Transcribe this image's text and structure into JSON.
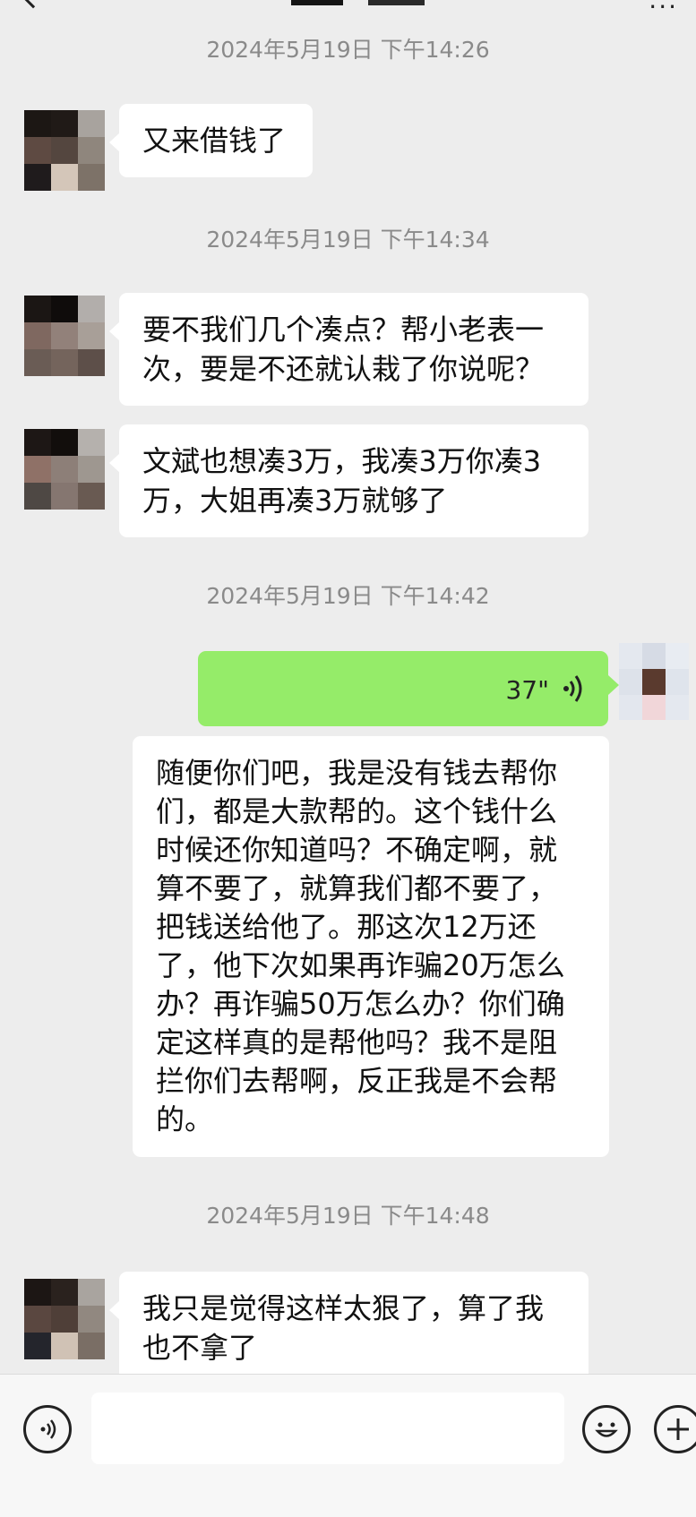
{
  "app": {
    "header": {
      "back_icon": "chevron-left-icon",
      "more_icon": "more-dots-icon",
      "more_text": "···"
    }
  },
  "messages": [
    {
      "kind": "timestamp",
      "text": "2024年5月19日 下午14:26"
    },
    {
      "kind": "incoming",
      "text": "又来借钱了"
    },
    {
      "kind": "timestamp",
      "text": "2024年5月19日 下午14:34"
    },
    {
      "kind": "incoming",
      "text": "要不我们几个凑点？帮小老表一\n次，要是不还就认栽了你说呢？"
    },
    {
      "kind": "incoming",
      "text": "文斌也想凑3万，我凑3万你凑3\n万，大姐再凑3万就够了"
    },
    {
      "kind": "timestamp",
      "text": "2024年5月19日 下午14:42"
    },
    {
      "kind": "outgoing-voice",
      "duration": "37\""
    },
    {
      "kind": "voice-transcript",
      "text": "随便你们吧，我是没有钱去帮你\n们，都是大款帮的。这个钱什么\n时候还你知道吗？不确定啊，就\n算不要了，就算我们都不要了，\n把钱送给他了。那这次12万还\n了，他下次如果再诈骗20万怎么\n办？再诈骗50万怎么办？你们确\n定这样真的是帮他吗？我不是阻\n拦你们去帮啊，反正我是不会帮\n的。"
    },
    {
      "kind": "timestamp",
      "text": "2024年5月19日 下午14:48"
    },
    {
      "kind": "incoming",
      "text": "我只是觉得这样太狠了，算了我\n也不拿了"
    }
  ],
  "input_bar": {
    "voice_button_icon": "voice-input-icon",
    "text_value": "",
    "emoji_button_icon": "emoji-icon",
    "plus_button_icon": "plus-icon"
  },
  "colors": {
    "background": "#ededed",
    "incoming_bubble": "#ffffff",
    "outgoing_bubble": "#95ec69",
    "timestamp_text": "#8a8a8a"
  }
}
